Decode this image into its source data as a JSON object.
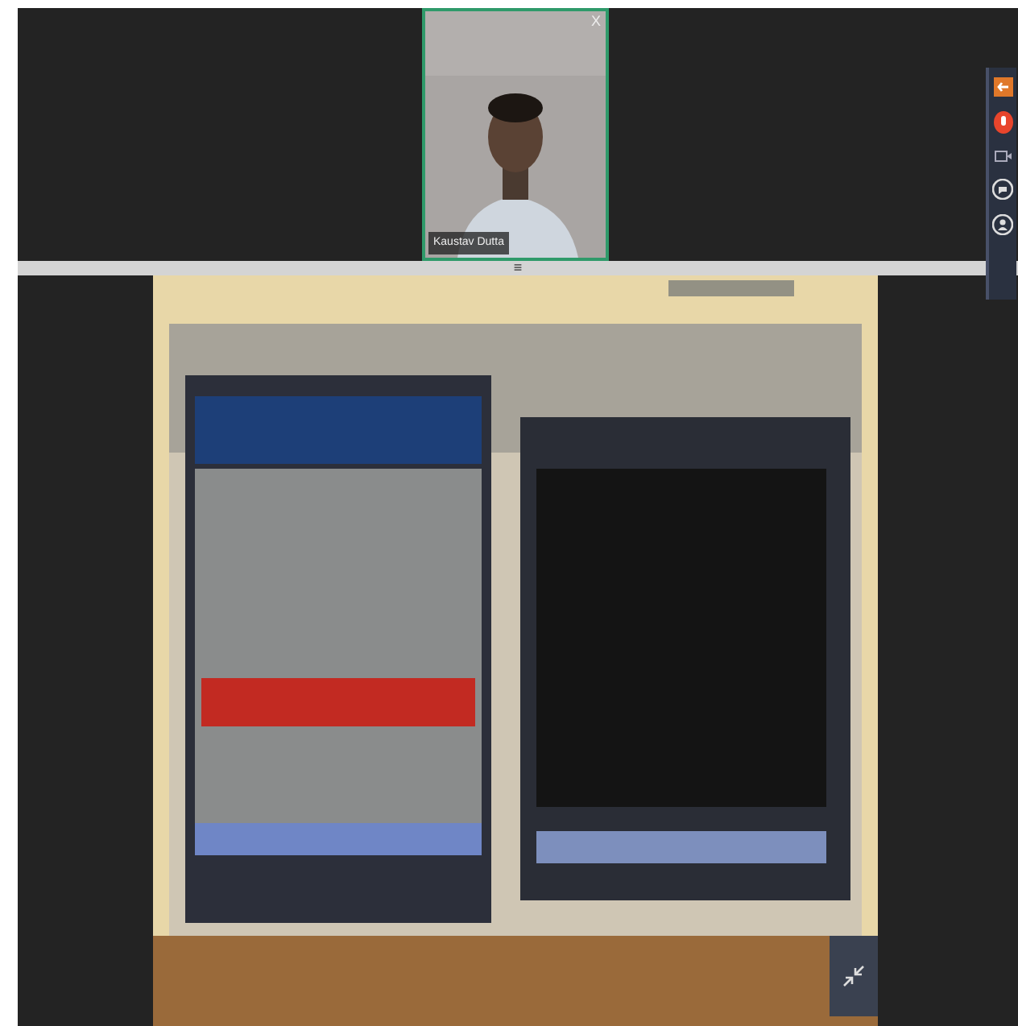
{
  "video_tile": {
    "name": "Kaustav Dutta",
    "close": "X"
  },
  "splitter": {
    "handle": "≡"
  }
}
